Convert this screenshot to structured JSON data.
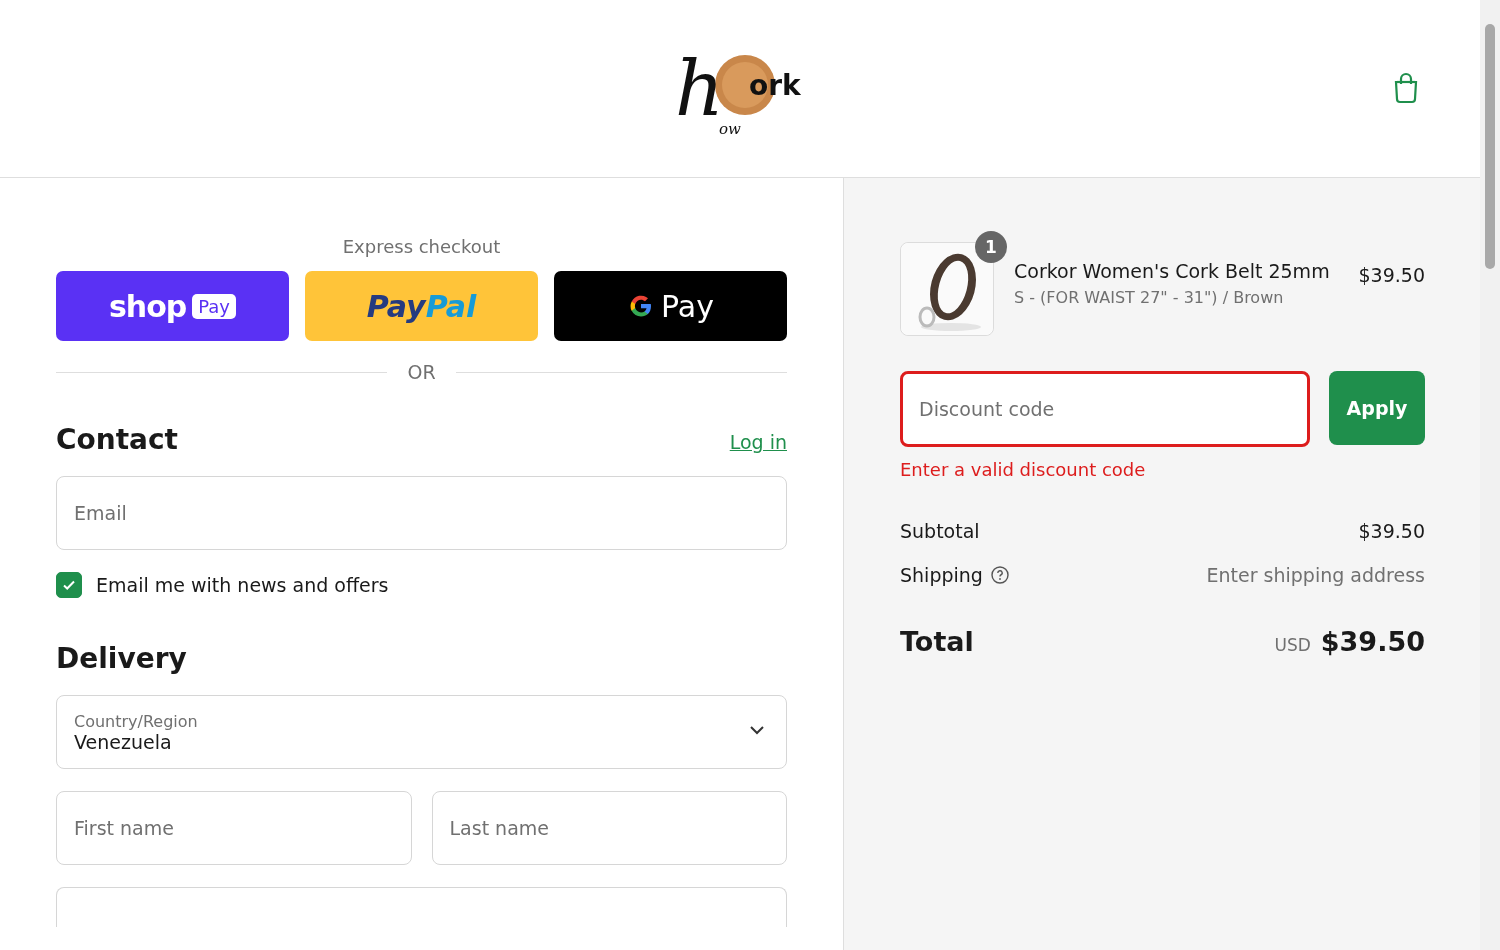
{
  "logo": {
    "initial": "h",
    "word": "ork",
    "small": "ow"
  },
  "express": {
    "title": "Express checkout",
    "buttons": [
      {
        "kind": "shop",
        "label": "shop",
        "badge": "Pay"
      },
      {
        "kind": "paypal",
        "label": "Pay",
        "label2": "Pal"
      },
      {
        "kind": "gpay",
        "label": "Pay"
      }
    ],
    "divider": "OR"
  },
  "contact": {
    "heading": "Contact",
    "login": "Log in",
    "email": {
      "placeholder": "Email"
    },
    "newsletter": {
      "label": "Email me with news and offers",
      "checked": true
    }
  },
  "delivery": {
    "heading": "Delivery",
    "country": {
      "label": "Country/Region",
      "value": "Venezuela"
    },
    "first_name": {
      "placeholder": "First name"
    },
    "last_name": {
      "placeholder": "Last name"
    }
  },
  "summary": {
    "item": {
      "name": "Corkor Women's Cork Belt 25mm",
      "variant": "S - (FOR WAIST 27\" - 31\") / Brown",
      "price": "$39.50",
      "quantity": "1"
    },
    "discount": {
      "placeholder": "Discount code",
      "error": "Enter a valid discount code",
      "invalid": true,
      "button": "Apply"
    },
    "subtotal": {
      "label": "Subtotal",
      "value": "$39.50"
    },
    "shipping": {
      "label": "Shipping",
      "value": "Enter shipping address"
    },
    "total": {
      "label": "Total",
      "currency": "USD",
      "value": "$39.50"
    }
  }
}
